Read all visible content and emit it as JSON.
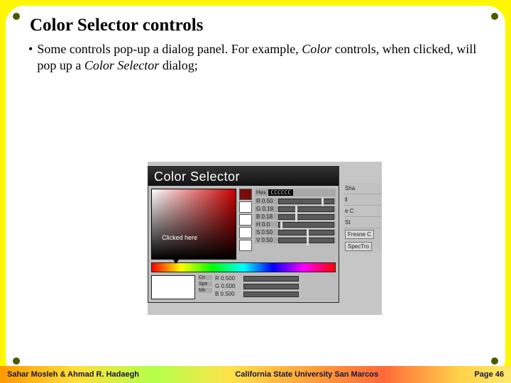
{
  "title": "Color Selector controls",
  "bullet": {
    "text_before_i1": "Some controls pop-up a dialog panel. For example, ",
    "i1": "Color",
    "text_mid": " controls, when clicked, will pop up a ",
    "i2": "Color Selector",
    "text_after": " dialog;"
  },
  "dialog": {
    "title": "Color Selector",
    "marker": "Clicked here",
    "hex_label": "Hex",
    "hex_val": "CCCCCC",
    "channels": [
      {
        "label": "R 0.50",
        "pos": 78
      },
      {
        "label": "G 0.18",
        "pos": 30
      },
      {
        "label": "B 0.18",
        "pos": 30
      },
      {
        "label": "H 0.0",
        "pos": 2
      },
      {
        "label": "S 0.50",
        "pos": 50
      },
      {
        "label": "V 0.50",
        "pos": 50
      }
    ],
    "bottom_labels": [
      "Co",
      "Spe",
      "Mir"
    ],
    "bottom_rgb": [
      {
        "label": "R 0.500"
      },
      {
        "label": "G 0.500"
      },
      {
        "label": "B 0.500"
      }
    ]
  },
  "bg_labels": [
    "Sha",
    "ll",
    "e C",
    "St",
    "Fresne C",
    "SpecTro"
  ],
  "footer": {
    "left": "Sahar Mosleh & Ahmad R. Hadaegh",
    "mid": "California State University San Marcos",
    "right_label": "Page",
    "right_num": "46"
  }
}
